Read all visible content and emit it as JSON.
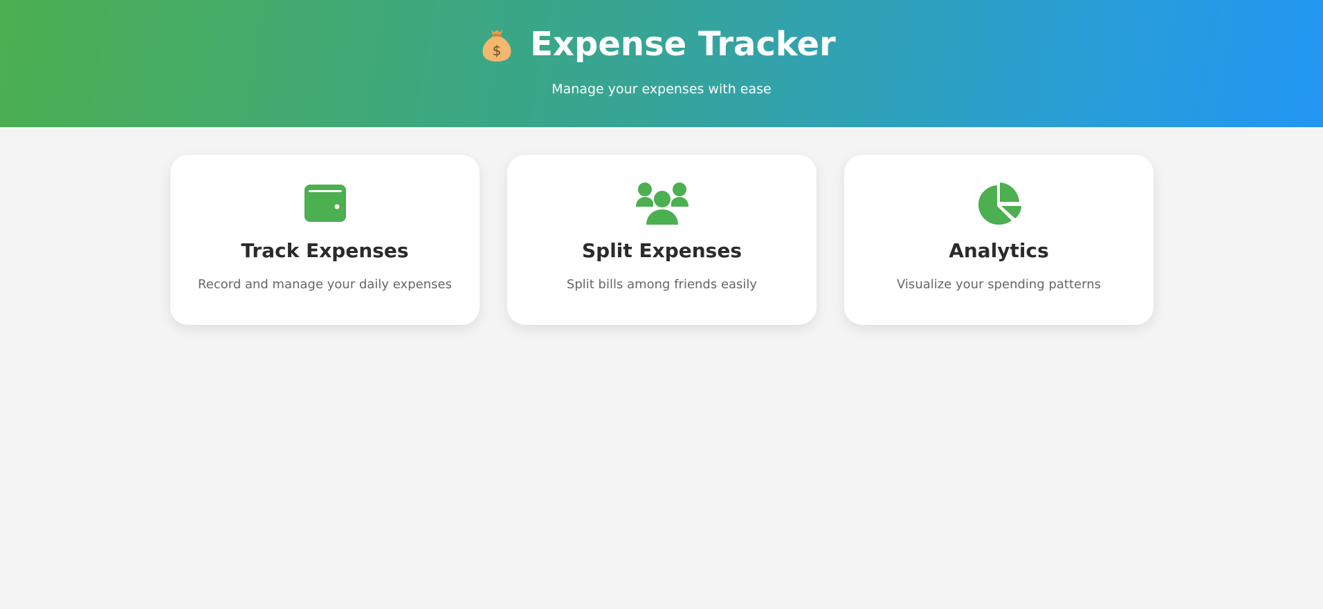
{
  "header": {
    "title": "Expense Tracker",
    "subtitle": "Manage your expenses with ease",
    "icon": "money-bag-icon",
    "gradient_start": "#4caf50",
    "gradient_end": "#2196f3"
  },
  "features": [
    {
      "title": "Track Expenses",
      "description": "Record and manage your daily expenses",
      "icon": "wallet-icon"
    },
    {
      "title": "Split Expenses",
      "description": "Split bills among friends easily",
      "icon": "users-icon"
    },
    {
      "title": "Analytics",
      "description": "Visualize your spending patterns",
      "icon": "pie-chart-icon"
    }
  ],
  "colors": {
    "accent": "#4caf50",
    "background": "#f4f4f4",
    "card": "#ffffff",
    "title_text": "#2b2b2b",
    "desc_text": "#666666"
  }
}
